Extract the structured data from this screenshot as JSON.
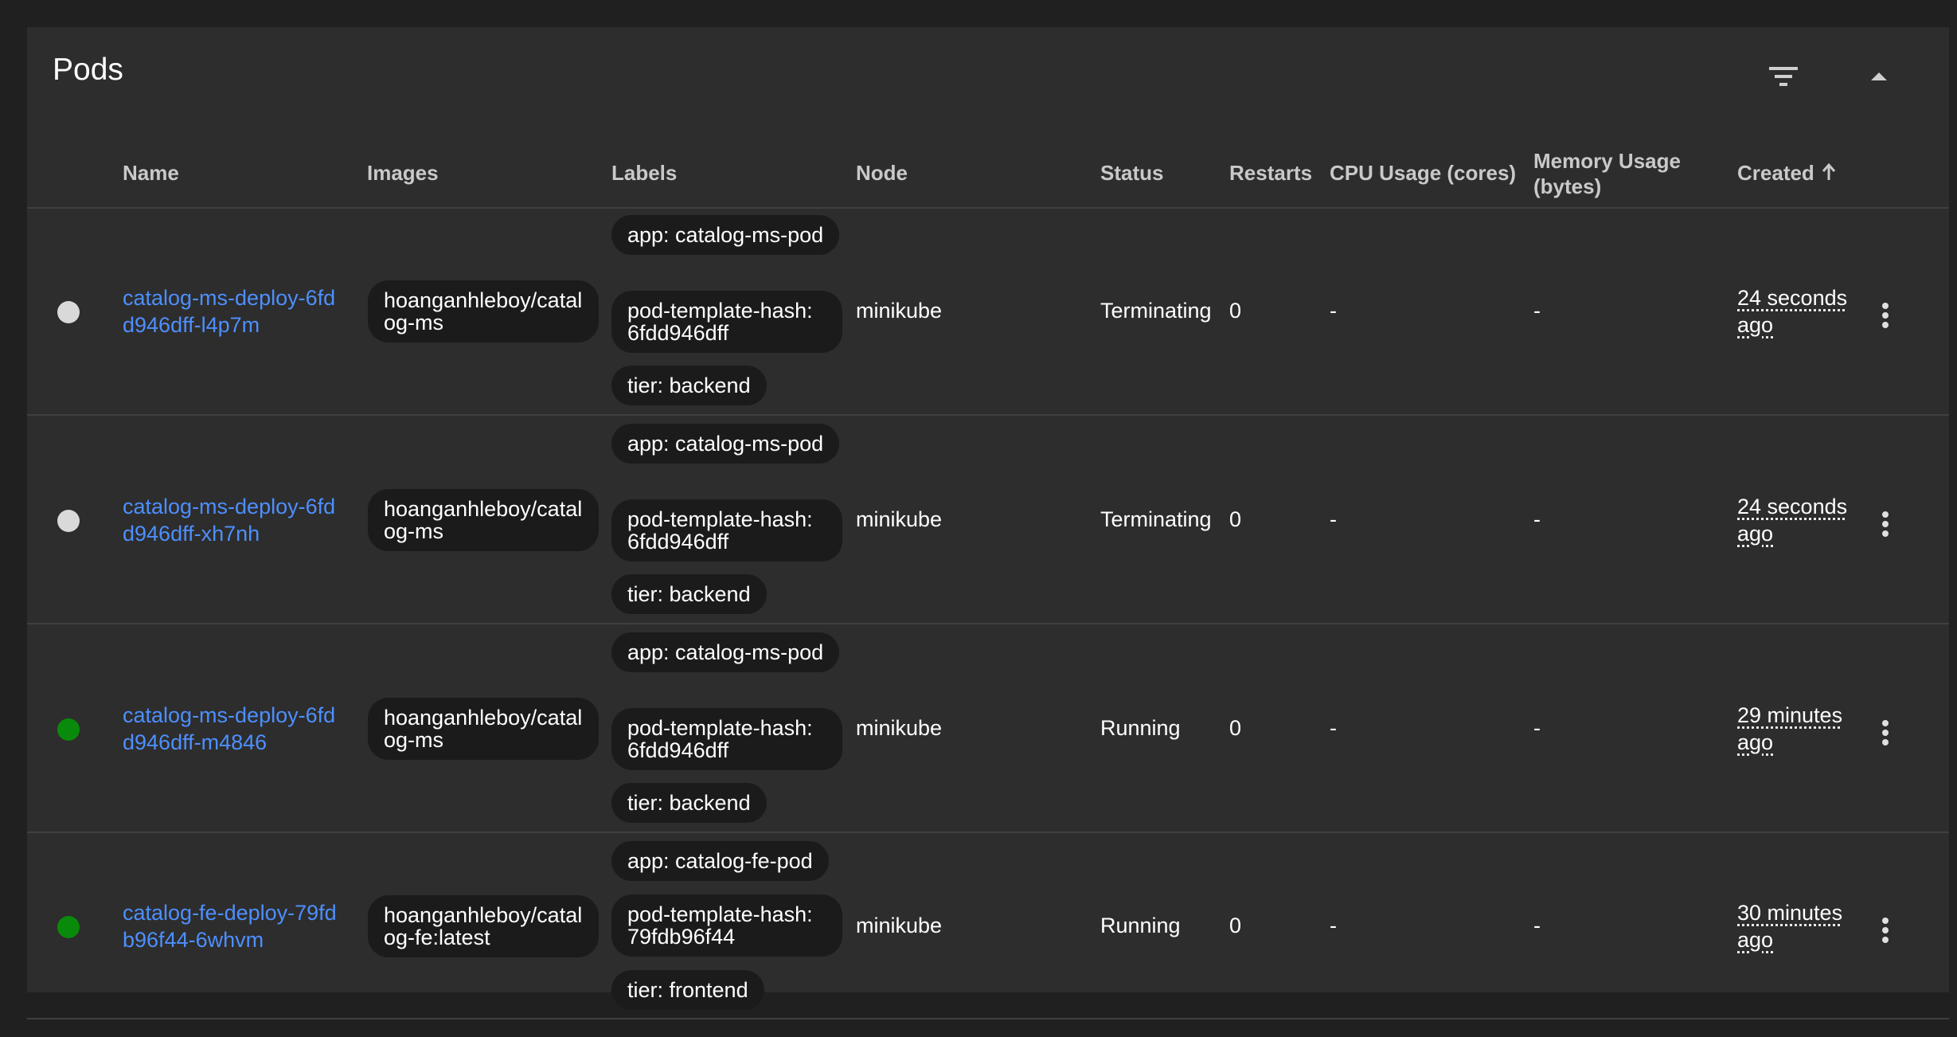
{
  "card": {
    "title": "Pods",
    "filter_icon": "filter-list-icon",
    "collapse_icon": "arrow-up-icon"
  },
  "columns": {
    "name": "Name",
    "images": "Images",
    "labels": "Labels",
    "node": "Node",
    "status": "Status",
    "restarts": "Restarts",
    "cpu": "CPU Usage (cores)",
    "memory": "Memory Usage (bytes)",
    "created": "Created"
  },
  "colors": {
    "status_terminating": "#d9d9d9",
    "status_running": "#0a8a0a",
    "link": "#4d8fff"
  },
  "rows": [
    {
      "name": "catalog-ms-deploy-6fdd946dff-l4p7m",
      "image": "hoanganhleboy/catalog-ms",
      "labels": [
        "app: catalog-ms-pod",
        "pod-template-hash: 6fdd946dff",
        "tier: backend"
      ],
      "node": "minikube",
      "status": "Terminating",
      "restarts": "0",
      "cpu": "-",
      "memory": "-",
      "created": "24 seconds ago"
    },
    {
      "name": "catalog-ms-deploy-6fdd946dff-xh7nh",
      "image": "hoanganhleboy/catalog-ms",
      "labels": [
        "app: catalog-ms-pod",
        "pod-template-hash: 6fdd946dff",
        "tier: backend"
      ],
      "node": "minikube",
      "status": "Terminating",
      "restarts": "0",
      "cpu": "-",
      "memory": "-",
      "created": "24 seconds ago"
    },
    {
      "name": "catalog-ms-deploy-6fdd946dff-m4846",
      "image": "hoanganhleboy/catalog-ms",
      "labels": [
        "app: catalog-ms-pod",
        "pod-template-hash: 6fdd946dff",
        "tier: backend"
      ],
      "node": "minikube",
      "status": "Running",
      "restarts": "0",
      "cpu": "-",
      "memory": "-",
      "created": "29 minutes ago"
    },
    {
      "name": "catalog-fe-deploy-79fdb96f44-6whvm",
      "image": "hoanganhleboy/catalog-fe:latest",
      "labels": [
        "app: catalog-fe-pod",
        "pod-template-hash: 79fdb96f44",
        "tier: frontend"
      ],
      "node": "minikube",
      "status": "Running",
      "restarts": "0",
      "cpu": "-",
      "memory": "-",
      "created": "30 minutes ago"
    }
  ]
}
